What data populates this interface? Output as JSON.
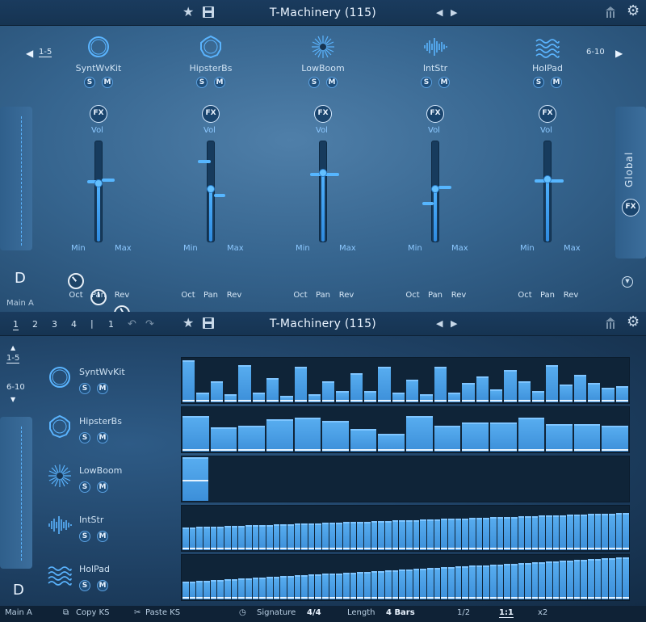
{
  "header": {
    "title": "T-Machinery (115)",
    "colors": {
      "accent": "#4fb2ff",
      "bg_top": "#1a3b5e",
      "lane_bg": "#0f2438"
    }
  },
  "mixer": {
    "page_left": "1-5",
    "page_right": "6-10",
    "side_right_label": "Global",
    "side_fx": "FX",
    "key_label": "D",
    "output_label": "Main A",
    "channels": [
      {
        "name": "SyntWvKit",
        "icon": "circle-ring-icon",
        "solo": "S",
        "mute": "M",
        "fx": "FX",
        "vol": "Vol",
        "min": "Min",
        "max": "Max",
        "oct": "Oct",
        "pan": "Pan",
        "rev": "Rev"
      },
      {
        "name": "HipsterBs",
        "icon": "flower-ring-icon",
        "solo": "S",
        "mute": "M",
        "fx": "FX",
        "vol": "Vol",
        "min": "Min",
        "max": "Max",
        "oct": "Oct",
        "pan": "Pan",
        "rev": "Rev"
      },
      {
        "name": "LowBoom",
        "icon": "starburst-icon",
        "solo": "S",
        "mute": "M",
        "fx": "FX",
        "vol": "Vol",
        "min": "Min",
        "max": "Max",
        "oct": "Oct",
        "pan": "Pan",
        "rev": "Rev"
      },
      {
        "name": "IntStr",
        "icon": "waveform-icon",
        "solo": "S",
        "mute": "M",
        "fx": "FX",
        "vol": "Vol",
        "min": "Min",
        "max": "Max",
        "oct": "Oct",
        "pan": "Pan",
        "rev": "Rev"
      },
      {
        "name": "HolPad",
        "icon": "waves-icon",
        "solo": "S",
        "mute": "M",
        "fx": "FX",
        "vol": "Vol",
        "min": "Min",
        "max": "Max",
        "oct": "Oct",
        "pan": "Pan",
        "rev": "Rev"
      }
    ],
    "fader_levels": [
      0.58,
      0.52,
      0.68,
      0.52,
      0.62
    ]
  },
  "sequencer": {
    "title": "T-Machinery (115)",
    "pages": [
      "1",
      "2",
      "3",
      "4"
    ],
    "pager_divider": "|",
    "pager_extra": "1",
    "page_up": "1-5",
    "page_down": "6-10",
    "key_label": "D",
    "output_label": "Main A",
    "tracks": [
      {
        "name": "SyntWvKit",
        "solo": "S",
        "mute": "M"
      },
      {
        "name": "HipsterBs",
        "solo": "S",
        "mute": "M"
      },
      {
        "name": "LowBoom",
        "solo": "S",
        "mute": "M"
      },
      {
        "name": "IntStr",
        "solo": "S",
        "mute": "M"
      },
      {
        "name": "HolPad",
        "solo": "S",
        "mute": "M"
      }
    ]
  },
  "footer": {
    "copy": "Copy KS",
    "paste": "Paste KS",
    "signature_label": "Signature",
    "signature_value": "4/4",
    "length_label": "Length",
    "length_value": "4 Bars",
    "zoom_half": "1/2",
    "zoom_one": "1:1",
    "zoom_double": "x2"
  }
}
